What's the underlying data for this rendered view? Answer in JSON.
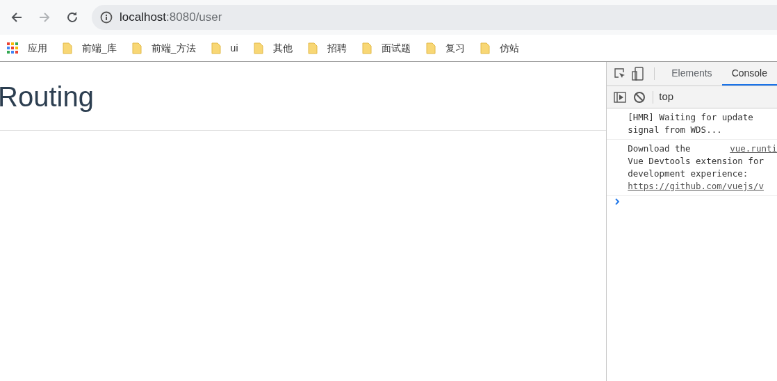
{
  "browser": {
    "nav": [
      {
        "kind": "back",
        "disabled": false
      },
      {
        "kind": "forward",
        "disabled": true
      },
      {
        "kind": "reload",
        "disabled": false
      }
    ],
    "url_host": "localhost",
    "url_rest": ":8080/user"
  },
  "bookmarks": [
    {
      "kind": "apps",
      "label": "应用"
    },
    {
      "kind": "folder",
      "label": "前端_库"
    },
    {
      "kind": "folder",
      "label": "前端_方法"
    },
    {
      "kind": "folder",
      "label": "ui"
    },
    {
      "kind": "folder",
      "label": "其他"
    },
    {
      "kind": "folder",
      "label": "招聘"
    },
    {
      "kind": "folder",
      "label": "面试题"
    },
    {
      "kind": "folder",
      "label": "复习"
    },
    {
      "kind": "folder",
      "label": "仿站"
    }
  ],
  "page": {
    "heading": "Routing"
  },
  "devtools": {
    "tabs": [
      {
        "label": "Elements",
        "selected": false
      },
      {
        "label": "Console",
        "selected": true
      }
    ],
    "context": "top",
    "messages": [
      {
        "lines": [
          [
            {
              "kind": "text",
              "text": "[HMR] Waiting for update"
            }
          ],
          [
            {
              "kind": "text",
              "text": "signal from WDS..."
            }
          ]
        ]
      },
      {
        "lines": [
          [
            {
              "kind": "text",
              "text": "Download the"
            },
            {
              "kind": "link",
              "text": "vue.runti"
            }
          ],
          [
            {
              "kind": "text",
              "text": "Vue Devtools extension for"
            }
          ],
          [
            {
              "kind": "text",
              "text": "development experience:"
            }
          ],
          [
            {
              "kind": "link",
              "text": "https://github.com/vuejs/v"
            }
          ]
        ]
      }
    ]
  }
}
